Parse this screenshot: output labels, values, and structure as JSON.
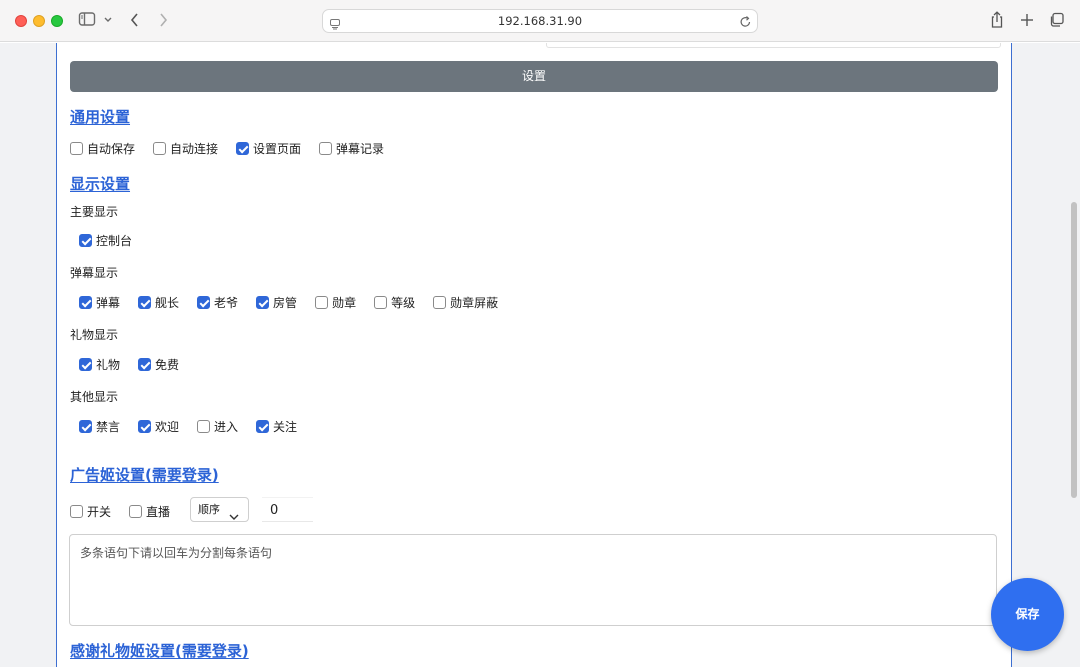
{
  "browser": {
    "url": "192.168.31.90"
  },
  "main": {
    "set_button_label": "设置",
    "general": {
      "title": "通用设置",
      "options": [
        {
          "label": "自动保存",
          "checked": false
        },
        {
          "label": "自动连接",
          "checked": false
        },
        {
          "label": "设置页面",
          "checked": true
        },
        {
          "label": "弹幕记录",
          "checked": false
        }
      ]
    },
    "display": {
      "title": "显示设置",
      "groups": [
        {
          "label": "主要显示",
          "options": [
            {
              "label": "控制台",
              "checked": true
            }
          ]
        },
        {
          "label": "弹幕显示",
          "options": [
            {
              "label": "弹幕",
              "checked": true
            },
            {
              "label": "舰长",
              "checked": true
            },
            {
              "label": "老爷",
              "checked": true
            },
            {
              "label": "房管",
              "checked": true
            },
            {
              "label": "勋章",
              "checked": false
            },
            {
              "label": "等级",
              "checked": false
            },
            {
              "label": "勋章屏蔽",
              "checked": false
            }
          ]
        },
        {
          "label": "礼物显示",
          "options": [
            {
              "label": "礼物",
              "checked": true
            },
            {
              "label": "免费",
              "checked": true
            }
          ]
        },
        {
          "label": "其他显示",
          "options": [
            {
              "label": "禁言",
              "checked": true
            },
            {
              "label": "欢迎",
              "checked": true
            },
            {
              "label": "进入",
              "checked": false
            },
            {
              "label": "关注",
              "checked": true
            }
          ]
        }
      ]
    },
    "ad": {
      "title": "广告姬设置(需要登录)",
      "switch": {
        "label": "开关",
        "checked": false
      },
      "live": {
        "label": "直播",
        "checked": false
      },
      "order_select": "顺序",
      "interval_value": "0",
      "textarea_placeholder": "多条语句下请以回车为分割每条语句"
    },
    "thanks": {
      "title": "感谢礼物姬设置(需要登录)"
    },
    "save_button": "保存"
  },
  "colors": {
    "accent": "#2f67d8",
    "title_link": "#2c63d6",
    "set_button_bg": "#6c757d",
    "fab_bg": "#2f6ff0"
  }
}
